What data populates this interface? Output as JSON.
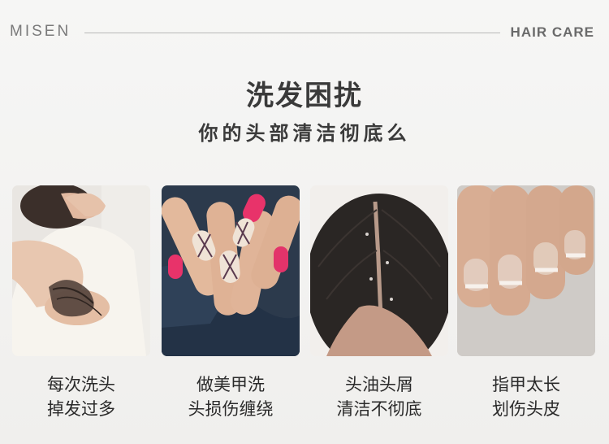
{
  "header": {
    "brand": "MISEN",
    "tag": "HAIR CARE"
  },
  "title": "洗发困扰",
  "subtitle": "你的头部清洁彻底么",
  "cards": [
    {
      "line1": "每次洗头",
      "line2": "掉发过多",
      "icon": "hair-loss-photo"
    },
    {
      "line1": "做美甲洗",
      "line2": "头损伤缠绕",
      "icon": "manicure-photo"
    },
    {
      "line1": "头油头屑",
      "line2": "清洁不彻底",
      "icon": "scalp-dandruff-photo"
    },
    {
      "line1": "指甲太长",
      "line2": "划伤头皮",
      "icon": "long-nails-photo"
    }
  ]
}
